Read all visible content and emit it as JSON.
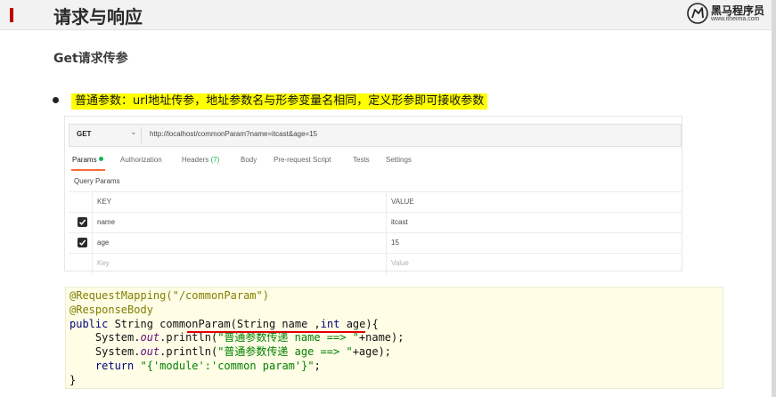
{
  "slide": {
    "title": "请求与响应",
    "subtitle": "Get请求传参",
    "bullet": "普通参数：url地址传参，地址参数名与形参变量名相同，定义形参即可接收参数",
    "logo": {
      "name": "黑马程序员",
      "url": "www.itheima.com",
      "icon": "horse-logo-icon"
    }
  },
  "postman": {
    "method": "GET",
    "url": "http://localhost/commonParam?name=itcast&age=15",
    "tabs": [
      {
        "label": "Params",
        "active": true
      },
      {
        "label": "Authorization"
      },
      {
        "label": "Headers",
        "count": "(7)"
      },
      {
        "label": "Body"
      },
      {
        "label": "Pre-request Script"
      },
      {
        "label": "Tests"
      },
      {
        "label": "Settings"
      }
    ],
    "query_params_label": "Query Params",
    "columns": [
      "KEY",
      "VALUE"
    ],
    "rows": [
      {
        "key": "name",
        "value": "itcast",
        "checked": true
      },
      {
        "key": "age",
        "value": "15",
        "checked": true
      }
    ],
    "placeholder": {
      "key": "Key",
      "value": "Value"
    },
    "colors": {
      "accent": "#ff6c37",
      "indicator": "#0cbb52"
    }
  },
  "code": {
    "lines": [
      "@RequestMapping(\"/commonParam\")",
      "@ResponseBody",
      "public String commonParam(String name ,int age){",
      "    System.out.println(\"普通参数传递 name ==> \"+name);",
      "    System.out.println(\"普通参数传递 age ==> \"+age);",
      "    return \"{'module':'common param'}\";",
      "}"
    ]
  },
  "colors": {
    "highlight": "#ffff00",
    "brand_red": "#c00000",
    "underline": "#e00000"
  }
}
